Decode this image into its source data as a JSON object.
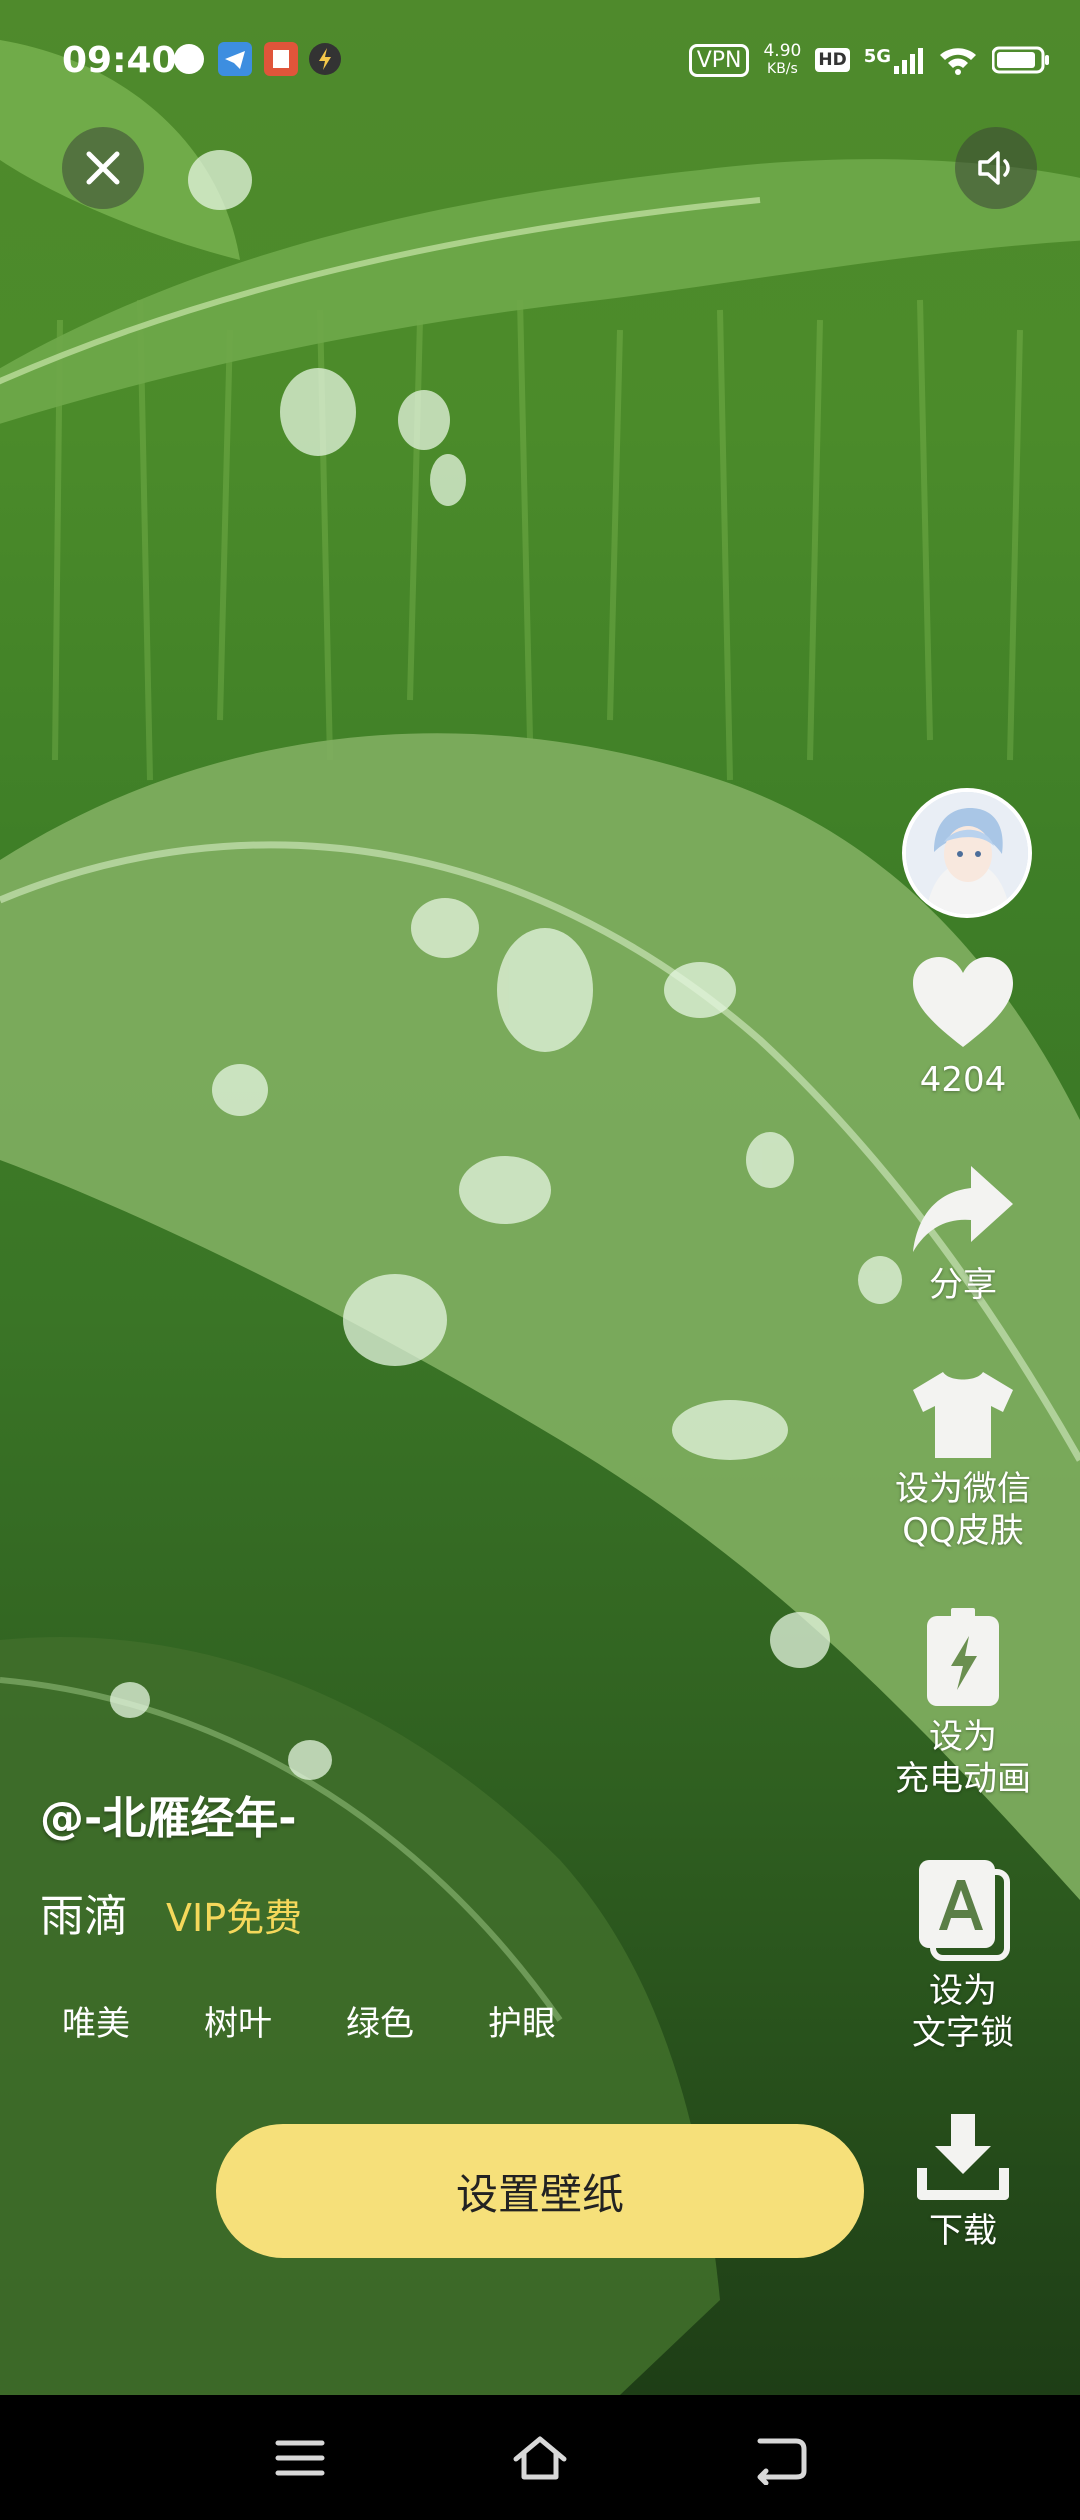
{
  "status_bar": {
    "time": "09:40",
    "vpn": "VPN",
    "net_speed_value": "4.90",
    "net_speed_unit": "KB/s",
    "hd": "HD",
    "signal": "5G"
  },
  "author": "@-北雁经年-",
  "wallpaper": {
    "title": "雨滴",
    "badge": "VIP免费",
    "tags": [
      "唯美",
      "树叶",
      "绿色",
      "护眼"
    ]
  },
  "rail": {
    "like_count": "4204",
    "share_label": "分享",
    "skin_label_line1": "设为微信",
    "skin_label_line2": "QQ皮肤",
    "charge_label_line1": "设为",
    "charge_label_line2": "充电动画",
    "textlock_label_line1": "设为",
    "textlock_label_line2": "文字锁",
    "download_label": "下载"
  },
  "cta_label": "设置壁纸"
}
